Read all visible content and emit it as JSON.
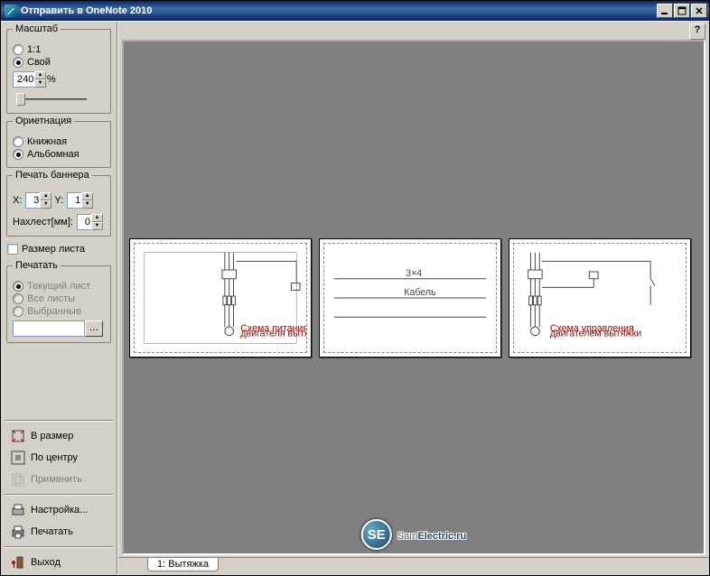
{
  "window": {
    "title": "Отправить в OneNote 2010"
  },
  "scale": {
    "group_label": "Масштаб",
    "opt_1_1": "1:1",
    "opt_custom": "Свой",
    "selected": "custom",
    "value": "240",
    "percent": "%"
  },
  "orientation": {
    "group_label": "Ориетнация",
    "opt_portrait": "Книжная",
    "opt_landscape": "Альбомная",
    "selected": "landscape"
  },
  "banner": {
    "group_label": "Печать баннера",
    "x_label": "X:",
    "x_value": "3",
    "y_label": "Y:",
    "y_value": "1",
    "overlap_label": "Нахлест[мм]:",
    "overlap_value": "0"
  },
  "sheetsize": {
    "label": "Размер листа",
    "checked": false
  },
  "print": {
    "group_label": "Печатать",
    "opt_current": "Текущий лист",
    "opt_all": "Все листы",
    "opt_selected": "Выбранные",
    "path_value": ""
  },
  "buttons": {
    "fit": "В размер",
    "center": "По центру",
    "apply": "Применить",
    "setup": "Настройка...",
    "print": "Печатать",
    "exit": "Выход"
  },
  "tab": {
    "label": "1: Вытяжка"
  },
  "help": {
    "glyph": "?"
  },
  "watermark": {
    "badge": "SE",
    "text_plain": "Sam",
    "text_bold": "Electric.ru"
  }
}
